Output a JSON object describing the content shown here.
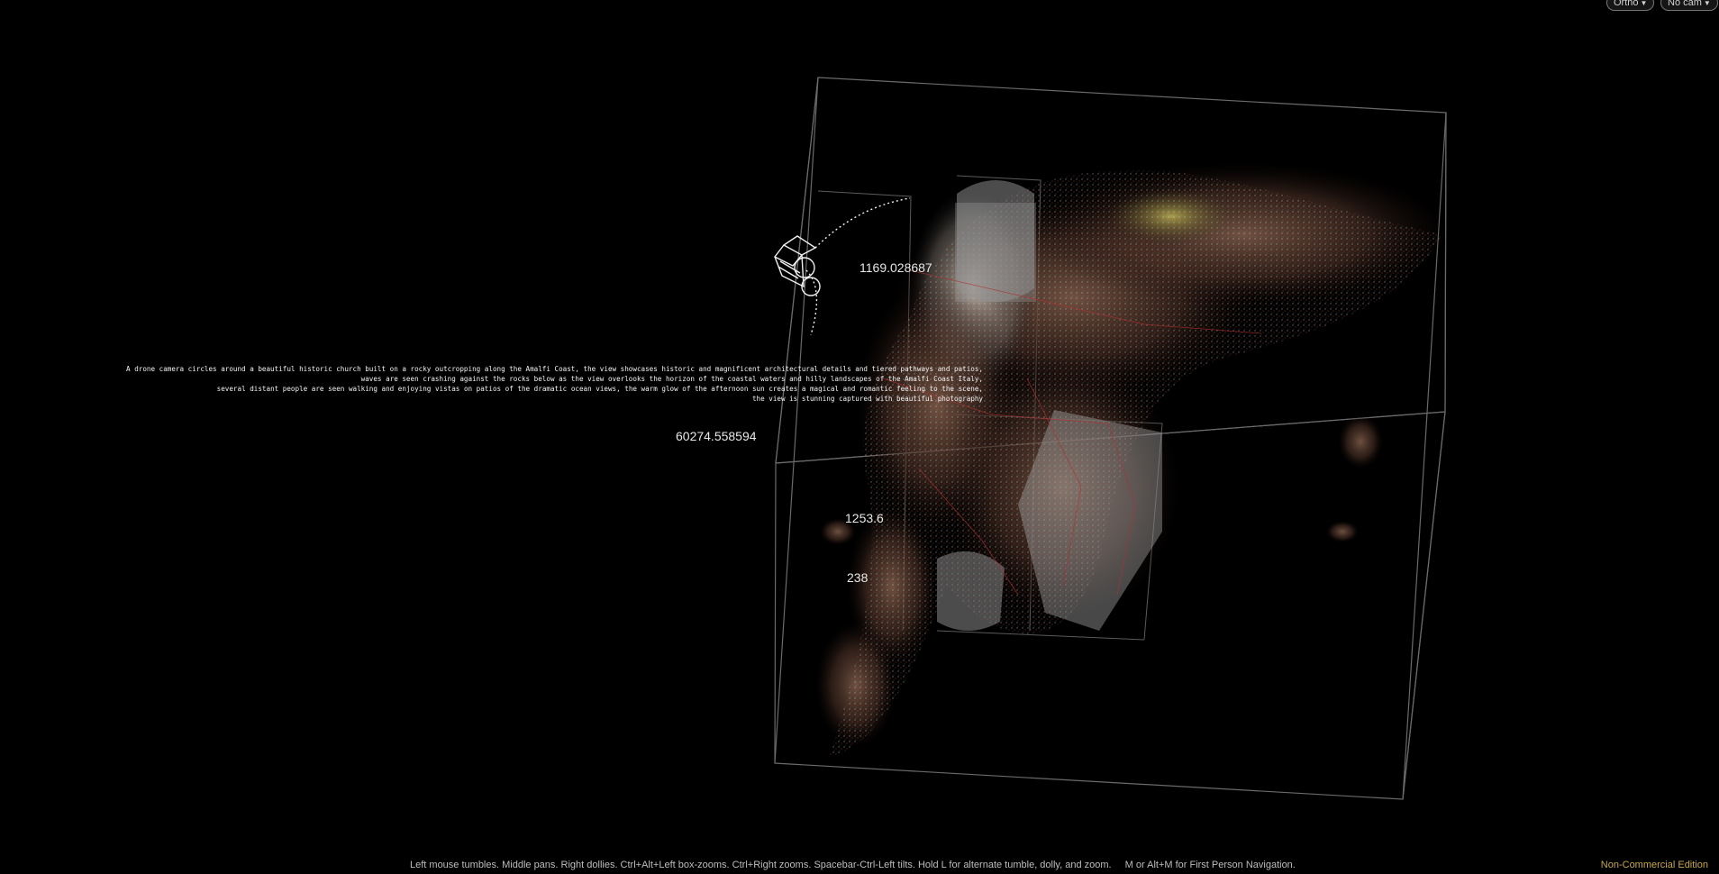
{
  "viewport": {
    "background": "#000000",
    "projection_button": "Ortho",
    "camera_button": "No cam"
  },
  "measurements": {
    "label_1": "1169.028687",
    "label_2": "60274.558594",
    "label_3": "1253.6",
    "label_4": "238"
  },
  "prompt": {
    "line_1": "A drone camera circles around a beautiful historic church built on a rocky outcropping along the Amalfi Coast, the view showcases historic and magnificent architectural details and tiered pathways and patios,",
    "line_2": "waves are seen crashing against the rocks below as the view overlooks the horizon of the coastal waters and hilly landscapes of the Amalfi Coast Italy,",
    "line_3": "several distant people are seen walking and enjoying vistas on patios of the dramatic ocean views, the warm glow of the afternoon sun creates a magical and romantic feeling to the scene,",
    "line_4": "the view is stunning captured with beautiful photography"
  },
  "status_bar": {
    "hint": "Left mouse tumbles. Middle pans. Right dollies. Ctrl+Alt+Left box-zooms. Ctrl+Right zooms. Spacebar-Ctrl-Left tilts. Hold L for alternate tumble, dolly, and zoom.",
    "hint_2": "M or Alt+M for First Person Navigation.",
    "edition": "Non-Commercial Edition"
  },
  "colors": {
    "edition_text": "#c8a846",
    "bounding_box": "#6a6a6a",
    "guide_red": "#b03030"
  }
}
